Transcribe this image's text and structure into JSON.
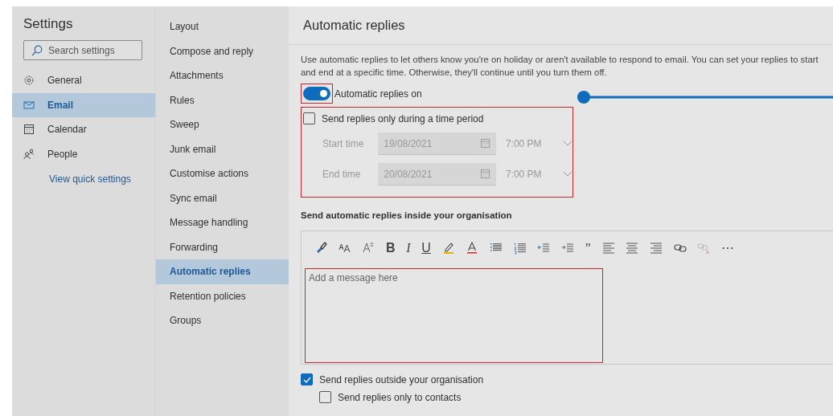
{
  "sidebar": {
    "title": "Settings",
    "search": {
      "placeholder": "Search settings"
    },
    "items": [
      {
        "label": "General",
        "selected": false
      },
      {
        "label": "Email",
        "selected": true
      },
      {
        "label": "Calendar",
        "selected": false
      },
      {
        "label": "People",
        "selected": false
      }
    ],
    "link": "View quick settings"
  },
  "subnav": {
    "items": [
      {
        "label": "Layout",
        "selected": false
      },
      {
        "label": "Compose and reply",
        "selected": false
      },
      {
        "label": "Attachments",
        "selected": false
      },
      {
        "label": "Rules",
        "selected": false
      },
      {
        "label": "Sweep",
        "selected": false
      },
      {
        "label": "Junk email",
        "selected": false
      },
      {
        "label": "Customise actions",
        "selected": false
      },
      {
        "label": "Sync email",
        "selected": false
      },
      {
        "label": "Message handling",
        "selected": false
      },
      {
        "label": "Forwarding",
        "selected": false
      },
      {
        "label": "Automatic replies",
        "selected": true
      },
      {
        "label": "Retention policies",
        "selected": false
      },
      {
        "label": "Groups",
        "selected": false
      }
    ]
  },
  "main": {
    "title": "Automatic replies",
    "description": [
      "Use automatic replies to let others know you're on holiday or aren't available to respond to email. You can set your replies to start",
      "and end at a specific time. Otherwise, they'll continue until you turn them off."
    ],
    "toggle": {
      "label": "Automatic replies on",
      "on": true
    },
    "time_period": {
      "label": "Send replies only during a time period",
      "checked": false,
      "rows": [
        {
          "label": "Start time",
          "date": "19/08/2021",
          "time": "7:00 PM"
        },
        {
          "label": "End time",
          "date": "20/08/2021",
          "time": "7:00 PM"
        }
      ]
    },
    "inside": {
      "heading": "Send automatic replies inside your organisation",
      "toolbar": [
        {
          "kind": "painter",
          "disabled": false
        },
        {
          "kind": "fontsize",
          "disabled": false
        },
        {
          "kind": "grow",
          "disabled": false
        },
        {
          "kind": "bold",
          "text": "B",
          "disabled": false
        },
        {
          "kind": "italic",
          "text": "I",
          "disabled": false
        },
        {
          "kind": "underline",
          "text": "U",
          "disabled": false
        },
        {
          "kind": "highlight",
          "disabled": false
        },
        {
          "kind": "fontcolor",
          "disabled": false
        },
        {
          "kind": "bullets",
          "disabled": false
        },
        {
          "kind": "numbers",
          "disabled": false
        },
        {
          "kind": "outdent",
          "disabled": false
        },
        {
          "kind": "indent",
          "disabled": false
        },
        {
          "kind": "quote",
          "text": "”",
          "disabled": false
        },
        {
          "kind": "alignleft",
          "disabled": false
        },
        {
          "kind": "aligncenter",
          "disabled": false
        },
        {
          "kind": "alignright",
          "disabled": false
        },
        {
          "kind": "link",
          "disabled": false
        },
        {
          "kind": "unlink",
          "disabled": true
        },
        {
          "kind": "more",
          "text": "⋯",
          "disabled": false
        }
      ],
      "message": {
        "placeholder": "Add a message here"
      }
    },
    "outside": {
      "label": "Send replies outside your organisation",
      "checked": true
    },
    "contacts": {
      "label": "Send replies only to contacts",
      "checked": false
    }
  }
}
